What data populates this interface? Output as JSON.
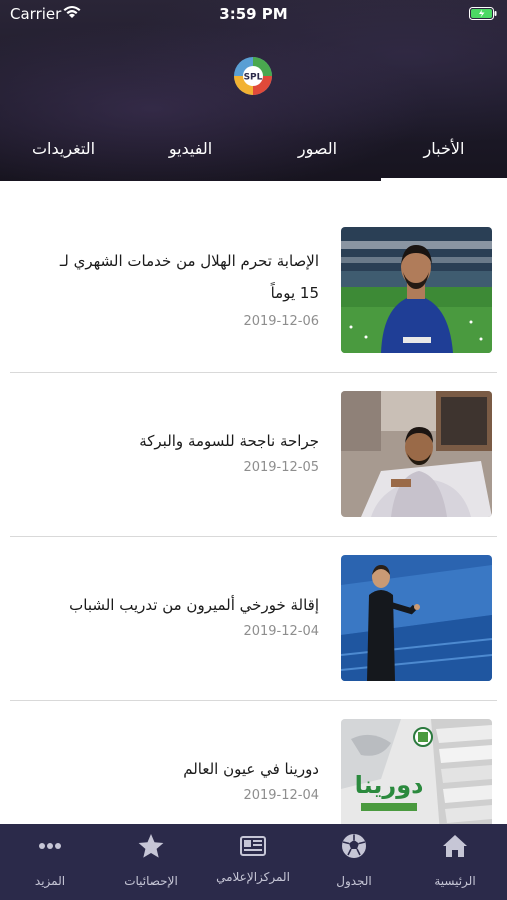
{
  "status": {
    "carrier": "Carrier",
    "time": "3:59 PM"
  },
  "logo": {
    "text": "SPL"
  },
  "tabs": [
    {
      "label": "الأخبار",
      "active": true
    },
    {
      "label": "الصور"
    },
    {
      "label": "الفيديو"
    },
    {
      "label": "التغريدات"
    }
  ],
  "news": [
    {
      "title_line1": "الإصابة تحرم الهلال من خدمات الشهري لـ",
      "title_line2": "15 يوماً",
      "date": "2019-12-06"
    },
    {
      "title_line1": "جراحة ناجحة للسومة والبركة",
      "date": "2019-12-05"
    },
    {
      "title_line1": "إقالة خورخي ألميرون من تدريب الشباب",
      "date": "2019-12-04"
    },
    {
      "title_line1": "دورينا في عيون العالم",
      "date": "2019-12-04",
      "thumb_text": "دورينا"
    }
  ],
  "bottom_nav": [
    {
      "label": "المزيد",
      "icon": "more-dots-icon"
    },
    {
      "label": "الإحصائيات",
      "icon": "star-icon"
    },
    {
      "label": "المركزالإعلامي",
      "icon": "newspaper-icon"
    },
    {
      "label": "الجدول",
      "icon": "soccer-ball-icon"
    },
    {
      "label": "الرئيسية",
      "icon": "home-icon"
    }
  ],
  "colors": {
    "header": "#1d1a29",
    "tabbar": "#2b2a4a",
    "date": "#8e8e8e"
  }
}
